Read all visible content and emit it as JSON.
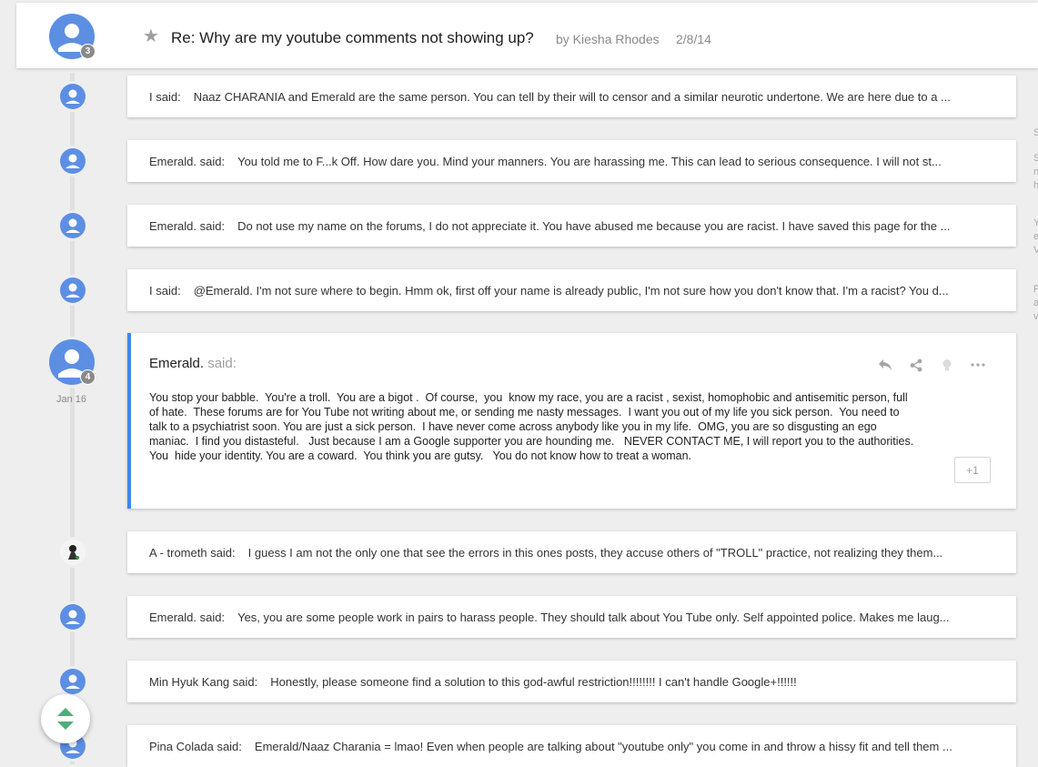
{
  "header": {
    "avatar_badge": "3",
    "title": "Re: Why are my youtube comments not showing up?",
    "by": "by Kiesha Rhodes",
    "date": "2/8/14"
  },
  "posts": [
    {
      "author": "I said:",
      "text": "Naaz CHARANIA and Emerald are the same person. You can tell by their will to censor and a similar neurotic undertone. We are here due to a ..."
    },
    {
      "author": "Emerald. said:",
      "text": "You told me to F...k Off. How dare you. Mind your manners. You are harassing me. This can lead to serious consequence. I will not st..."
    },
    {
      "author": "Emerald. said:",
      "text": "Do not use my name on the forums, I do not appreciate it. You have abused me because you are racist. I have saved this page for the ..."
    },
    {
      "author": "I said:",
      "text": "@Emerald. I'm not sure where to begin. Hmm ok, first off your name is already public, I'm not sure how you don't know that. I'm a racist? You d..."
    }
  ],
  "expanded": {
    "name": "Emerald.",
    "said": "said:",
    "badge": "4",
    "date": "Jan 16",
    "body": "You stop your babble.  You're a troll.  You are a bigot .  Of course,  you  know my race, you are a racist , sexist, homophobic and antisemitic person, full\nof hate.  These forums are for You Tube not writing about me, or sending me nasty messages.  I want you out of my life you sick person.  You need to\ntalk to a psychiatrist soon. You are just a sick person.  I have never come across anybody like you in my life.  OMG, you are so disgusting an ego\nmaniac.  I find you distasteful.   Just because I am a Google supporter you are hounding me.   NEVER CONTACT ME, I will report you to the authorities.\nYou  hide your identity. You are a coward.  You think you are gutsy.   You do not know how to treat a woman.",
    "plus_one": "+1",
    "actions": [
      "reply-icon",
      "share-icon",
      "lightbulb-icon",
      "more-icon"
    ]
  },
  "posts_after": [
    {
      "author": "A - trometh said:",
      "text": "I guess I am not the only one that see the errors in this ones posts, they accuse others of \"TROLL\" practice, not realizing they them..."
    },
    {
      "author": "Emerald. said:",
      "text": "Yes, you are some people work in pairs to harass people. They should talk about You Tube only. Self appointed police. Makes me laug..."
    },
    {
      "author": "Min Hyuk Kang said:",
      "text": "Honestly, please someone find a solution to this god-awful restriction!!!!!!!! I can't handle Google+!!!!!!"
    },
    {
      "author": "Pina Colada said:",
      "text": "Emerald/Naaz Charania = lmao! Even when people are talking about \"youtube only\" you come in and throw a hissy fit and tell them ..."
    }
  ],
  "edge_letters": [
    "S",
    "S",
    "n",
    "h",
    "Y",
    "e",
    "V",
    "F",
    "a",
    "v"
  ],
  "colors": {
    "accent": "#4285f4",
    "avatar": "#5c8fe4",
    "fab_arrow": "#4caf7a"
  }
}
